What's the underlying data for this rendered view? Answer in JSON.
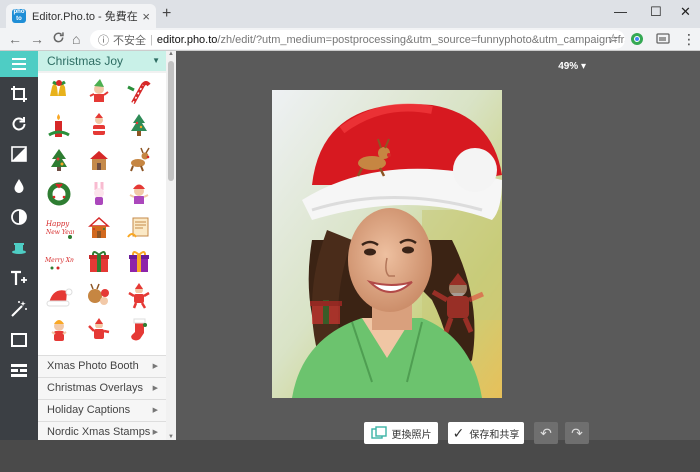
{
  "browser": {
    "tab_title": "Editor.Pho.to - 免費在线照片編輯",
    "tab_favicon": "pho to",
    "close_glyph": "×",
    "new_tab_glyph": "+",
    "minimize_glyph": "—",
    "maximize_glyph": "☐",
    "window_close_glyph": "✕",
    "back_glyph": "←",
    "forward_glyph": "→",
    "reload_glyph": "C",
    "home_glyph": "⌂",
    "info_glyph": "ⓘ",
    "insecure_label": "不安全",
    "separator": "|",
    "url_host": "editor.pho.to",
    "url_path": "/zh/edit/?utm_medium=postprocessing&utm_source=funnyphoto&utm_campaign=frames...",
    "star_glyph": "☆",
    "menu_glyph": "⋮"
  },
  "toolbar": {
    "tools": [
      "menu-icon",
      "crop-icon",
      "rotate-icon",
      "exposure-icon",
      "color-drop-icon",
      "contrast-icon",
      "stickers-icon",
      "text-icon",
      "magic-wand-icon",
      "frame-icon",
      "texture-icon"
    ]
  },
  "panel": {
    "header": "Christmas Joy",
    "header_caret": "▼",
    "categories": [
      {
        "label": "Xmas Photo Booth",
        "arrow": "▶"
      },
      {
        "label": "Christmas Overlays",
        "arrow": "▶"
      },
      {
        "label": "Holiday Captions",
        "arrow": "▶"
      },
      {
        "label": "Nordic Xmas Stamps",
        "arrow": "▶"
      }
    ],
    "scroll_up": "▲",
    "scroll_down": "▼"
  },
  "canvas": {
    "zoom": "49% ▾"
  },
  "bottom": {
    "change_photo": "更換照片",
    "save_share": "保存和共享",
    "save_check": "✓",
    "undo_glyph": "↶",
    "redo_glyph": "↷"
  },
  "colors": {
    "accent": "#4ecdc4",
    "toolbar_bg": "#3b3f44",
    "panel_header_bg": "#c9f1e8",
    "canvas_bg": "#5a5a5a"
  }
}
